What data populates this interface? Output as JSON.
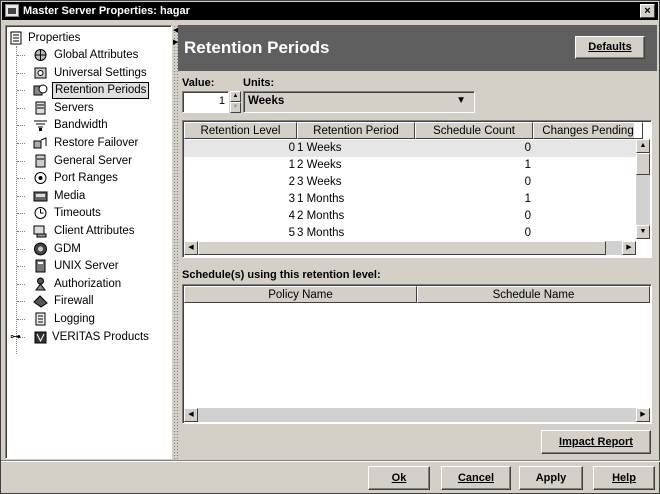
{
  "window": {
    "title": "Master Server Properties: hagar",
    "close_label": "×"
  },
  "tree": {
    "root": "Properties",
    "items": [
      {
        "label": "Global Attributes",
        "icon": "globe-icon"
      },
      {
        "label": "Universal Settings",
        "icon": "settings-icon"
      },
      {
        "label": "Retention Periods",
        "icon": "retention-icon",
        "selected": true
      },
      {
        "label": "Servers",
        "icon": "server-icon"
      },
      {
        "label": "Bandwidth",
        "icon": "bandwidth-icon"
      },
      {
        "label": "Restore Failover",
        "icon": "failover-icon"
      },
      {
        "label": "General Server",
        "icon": "general-server-icon"
      },
      {
        "label": "Port Ranges",
        "icon": "port-icon"
      },
      {
        "label": "Media",
        "icon": "media-icon"
      },
      {
        "label": "Timeouts",
        "icon": "clock-icon"
      },
      {
        "label": "Client Attributes",
        "icon": "client-icon"
      },
      {
        "label": "GDM",
        "icon": "gdm-icon"
      },
      {
        "label": "UNIX Server",
        "icon": "unix-server-icon"
      },
      {
        "label": "Authorization",
        "icon": "authorization-icon"
      },
      {
        "label": "Firewall",
        "icon": "firewall-icon"
      },
      {
        "label": "Logging",
        "icon": "logging-icon"
      },
      {
        "label": "VERITAS Products",
        "icon": "veritas-icon"
      }
    ]
  },
  "header": {
    "title": "Retention Periods",
    "defaults_label": "Defaults"
  },
  "value_label": "Value:",
  "units_label": "Units:",
  "value": "1",
  "units": "Weeks",
  "retention_table": {
    "columns": [
      "Retention Level",
      "Retention Period",
      "Schedule Count",
      "Changes Pending"
    ],
    "rows": [
      [
        "0",
        "1 Weeks",
        "0",
        ""
      ],
      [
        "1",
        "2 Weeks",
        "1",
        ""
      ],
      [
        "2",
        "3 Weeks",
        "0",
        ""
      ],
      [
        "3",
        "1 Months",
        "1",
        ""
      ],
      [
        "4",
        "2 Months",
        "0",
        ""
      ],
      [
        "5",
        "3 Months",
        "0",
        ""
      ]
    ]
  },
  "schedules_label": "Schedule(s) using this retention level:",
  "schedule_table": {
    "columns": [
      "Policy Name",
      "Schedule Name"
    ]
  },
  "impact_report_label": "Impact Report",
  "footer": {
    "ok": "Ok",
    "cancel": "Cancel",
    "apply": "Apply",
    "help": "Help"
  }
}
